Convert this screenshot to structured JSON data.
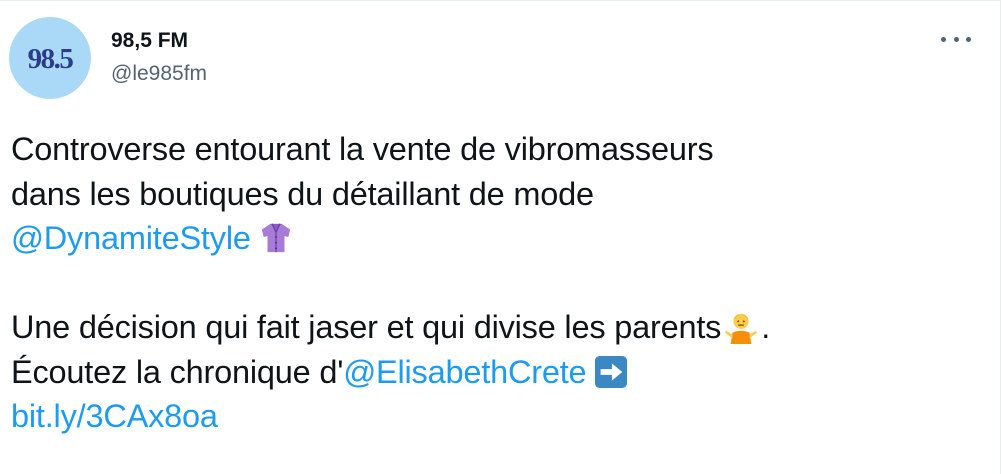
{
  "account": {
    "avatar_text": "98.5",
    "display_name": "98,5 FM",
    "handle": "@le985fm"
  },
  "tweet": {
    "line1": "Controverse entourant la vente de vibromasseurs",
    "line2": "dans les boutiques du détaillant de mode",
    "mention_dynamite": "@DynamiteStyle",
    "line4_text": "Une décision qui fait jaser et qui divise les parents",
    "line4_end": ".",
    "line5_prefix": "Écoutez la chronique d'",
    "mention_elisabeth": "@ElisabethCrete",
    "link": "bit.ly/3CAx8oa"
  },
  "icons": {
    "more": "more-horizontal-icon",
    "shirt": "shirt-emoji",
    "shrug": "person-shrugging-emoji",
    "arrow": "right-arrow-emoji"
  },
  "colors": {
    "accent": "#1d9bf0",
    "text": "#0f1419",
    "secondary": "#536471",
    "avatar_bg": "#a9d9f7",
    "avatar_text": "#2b3c8c"
  }
}
